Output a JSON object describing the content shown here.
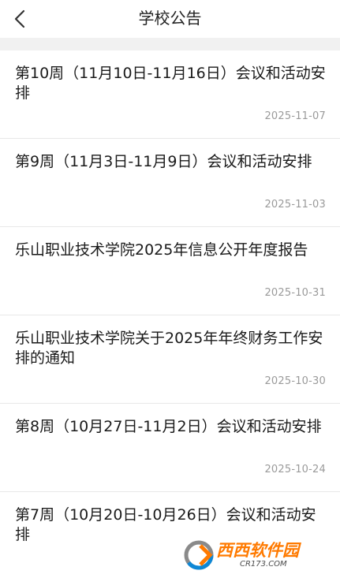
{
  "header": {
    "title": "学校公告",
    "back_icon": "chevron-left-icon"
  },
  "notices": [
    {
      "title": "第10周（11月10日-11月16日）会议和活动安排",
      "date": "2025-11-07"
    },
    {
      "title": "第9周（11月3日-11月9日）会议和活动安排",
      "date": "2025-11-03"
    },
    {
      "title": "乐山职业技术学院2025年信息公开年度报告",
      "date": "2025-10-31"
    },
    {
      "title": "乐山职业技术学院关于2025年年终财务工作安排的通知",
      "date": "2025-10-30"
    },
    {
      "title": "第8周（10月27日-11月2日）会议和活动安排",
      "date": "2025-10-24"
    },
    {
      "title": "第7周（10月20日-10月26日）会议和活动安排",
      "date": ""
    }
  ],
  "watermark": {
    "brand": "西西软件园",
    "url": "CR173.COM"
  }
}
